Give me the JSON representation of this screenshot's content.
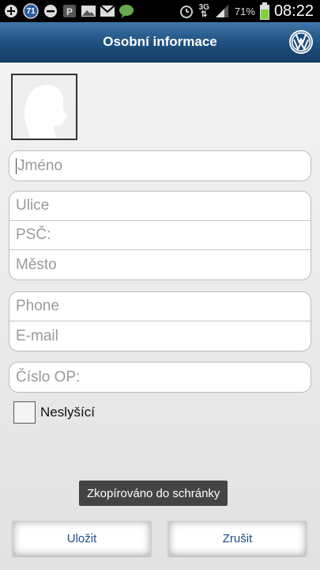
{
  "status_bar": {
    "notification_count": "71",
    "network": "3G",
    "battery_percent": "71%",
    "time": "08:22",
    "icons": [
      "plus-circle-icon",
      "notification-count-icon",
      "minus-circle-icon",
      "parking-icon",
      "image-icon",
      "gmail-icon",
      "chat-icon",
      "alarm-icon",
      "3g-icon",
      "signal-icon",
      "battery-icon"
    ]
  },
  "header": {
    "title": "Osobní informace"
  },
  "form": {
    "name_placeholder": "Jméno",
    "street_placeholder": "Ulice",
    "zip_placeholder": "PSČ:",
    "city_placeholder": "Město",
    "phone_placeholder": "Phone",
    "email_placeholder": "E-mail",
    "id_number_placeholder": "Číslo OP:",
    "deaf_checkbox_label": "Neslyšící",
    "deaf_checked": false
  },
  "toast": {
    "message": "Zkopírováno do schránky"
  },
  "buttons": {
    "save_label": "Uložit",
    "cancel_label": "Zrušit"
  },
  "colors": {
    "header_top": "#3f76a8",
    "header_bottom": "#153d64",
    "button_text": "#1f4f8a",
    "battery": "#7fd23a"
  }
}
